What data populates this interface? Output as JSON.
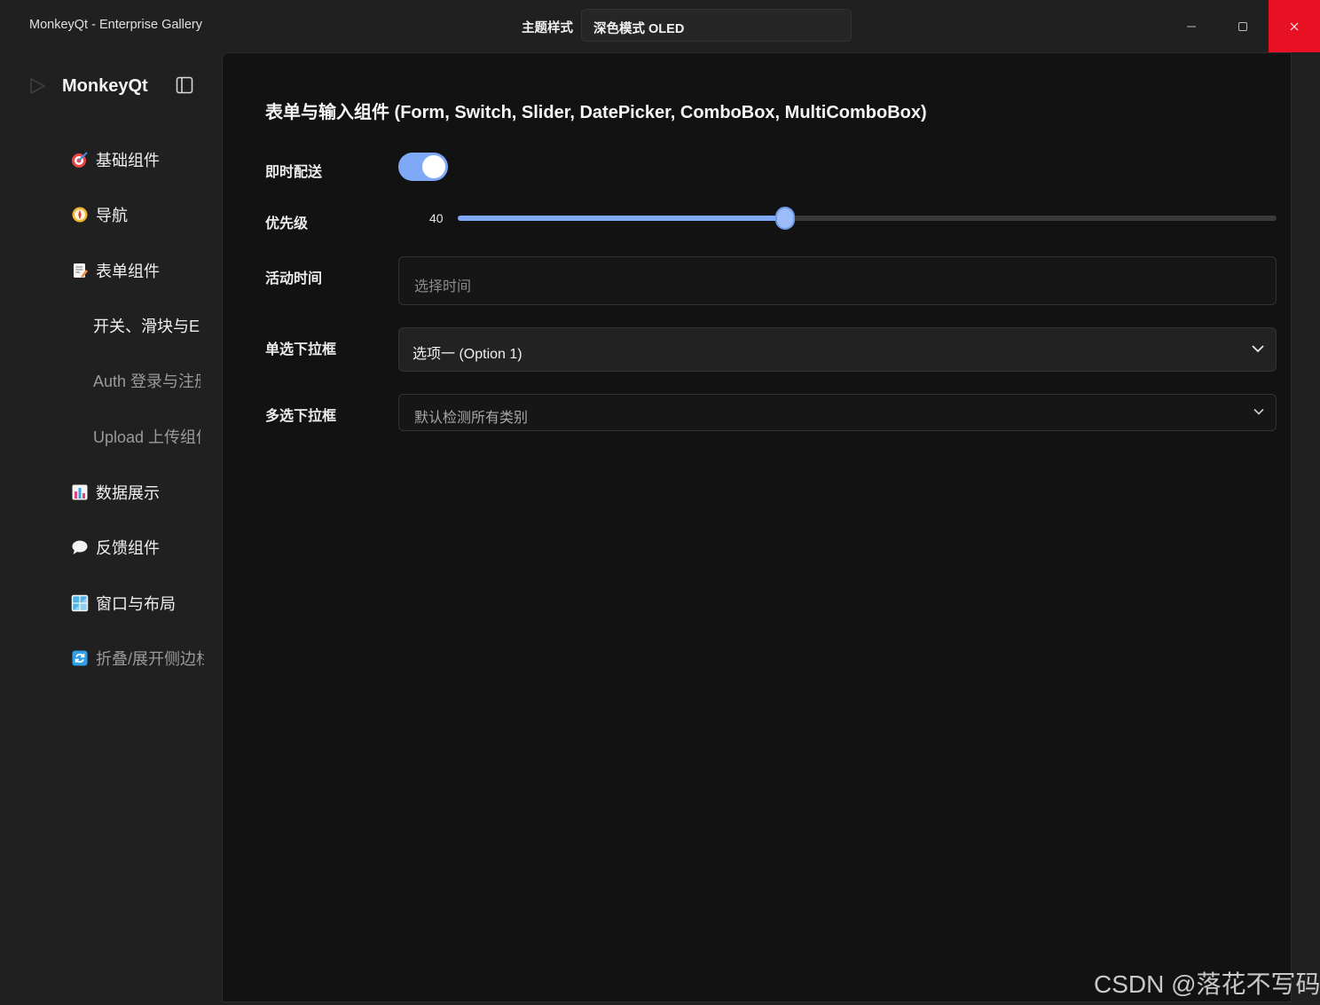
{
  "window": {
    "title": "MonkeyQt - Enterprise Gallery",
    "theme_label": "主题样式",
    "theme_value": "深色模式 OLED"
  },
  "sidebar": {
    "brand": "MonkeyQt",
    "items": [
      {
        "label": "基础组件",
        "icon": "dart-target-icon"
      },
      {
        "label": "导航",
        "icon": "compass-icon"
      },
      {
        "label": "表单组件",
        "icon": "memo-icon"
      },
      {
        "label": "开关、滑块与E",
        "icon": ""
      },
      {
        "label": "Auth 登录与注册",
        "icon": ""
      },
      {
        "label": "Upload 上传组件",
        "icon": ""
      },
      {
        "label": "数据展示",
        "icon": "bar-chart-icon"
      },
      {
        "label": "反馈组件",
        "icon": "speech-bubble-icon"
      },
      {
        "label": "窗口与布局",
        "icon": "window-icon"
      },
      {
        "label": "折叠/展开侧边栏",
        "icon": "refresh-icon"
      }
    ]
  },
  "form": {
    "title": "表单与输入组件 (Form, Switch, Slider, DatePicker, ComboBox, MultiComboBox)",
    "instant_delivery_label": "即时配送",
    "instant_delivery_on": true,
    "priority_label": "优先级",
    "priority_value": "40",
    "priority_fraction": 0.4,
    "activity_time_label": "活动时间",
    "activity_time_placeholder": "选择时间",
    "single_select_label": "单选下拉框",
    "single_select_value": "选项一 (Option 1)",
    "multi_select_label": "多选下拉框",
    "multi_select_placeholder": "默认检测所有类别"
  },
  "colors": {
    "accent": "#7fa9f7",
    "close_button": "#e81123",
    "background": "#121212",
    "sidebar": "#202020"
  },
  "watermark": "CSDN @落花不写码"
}
